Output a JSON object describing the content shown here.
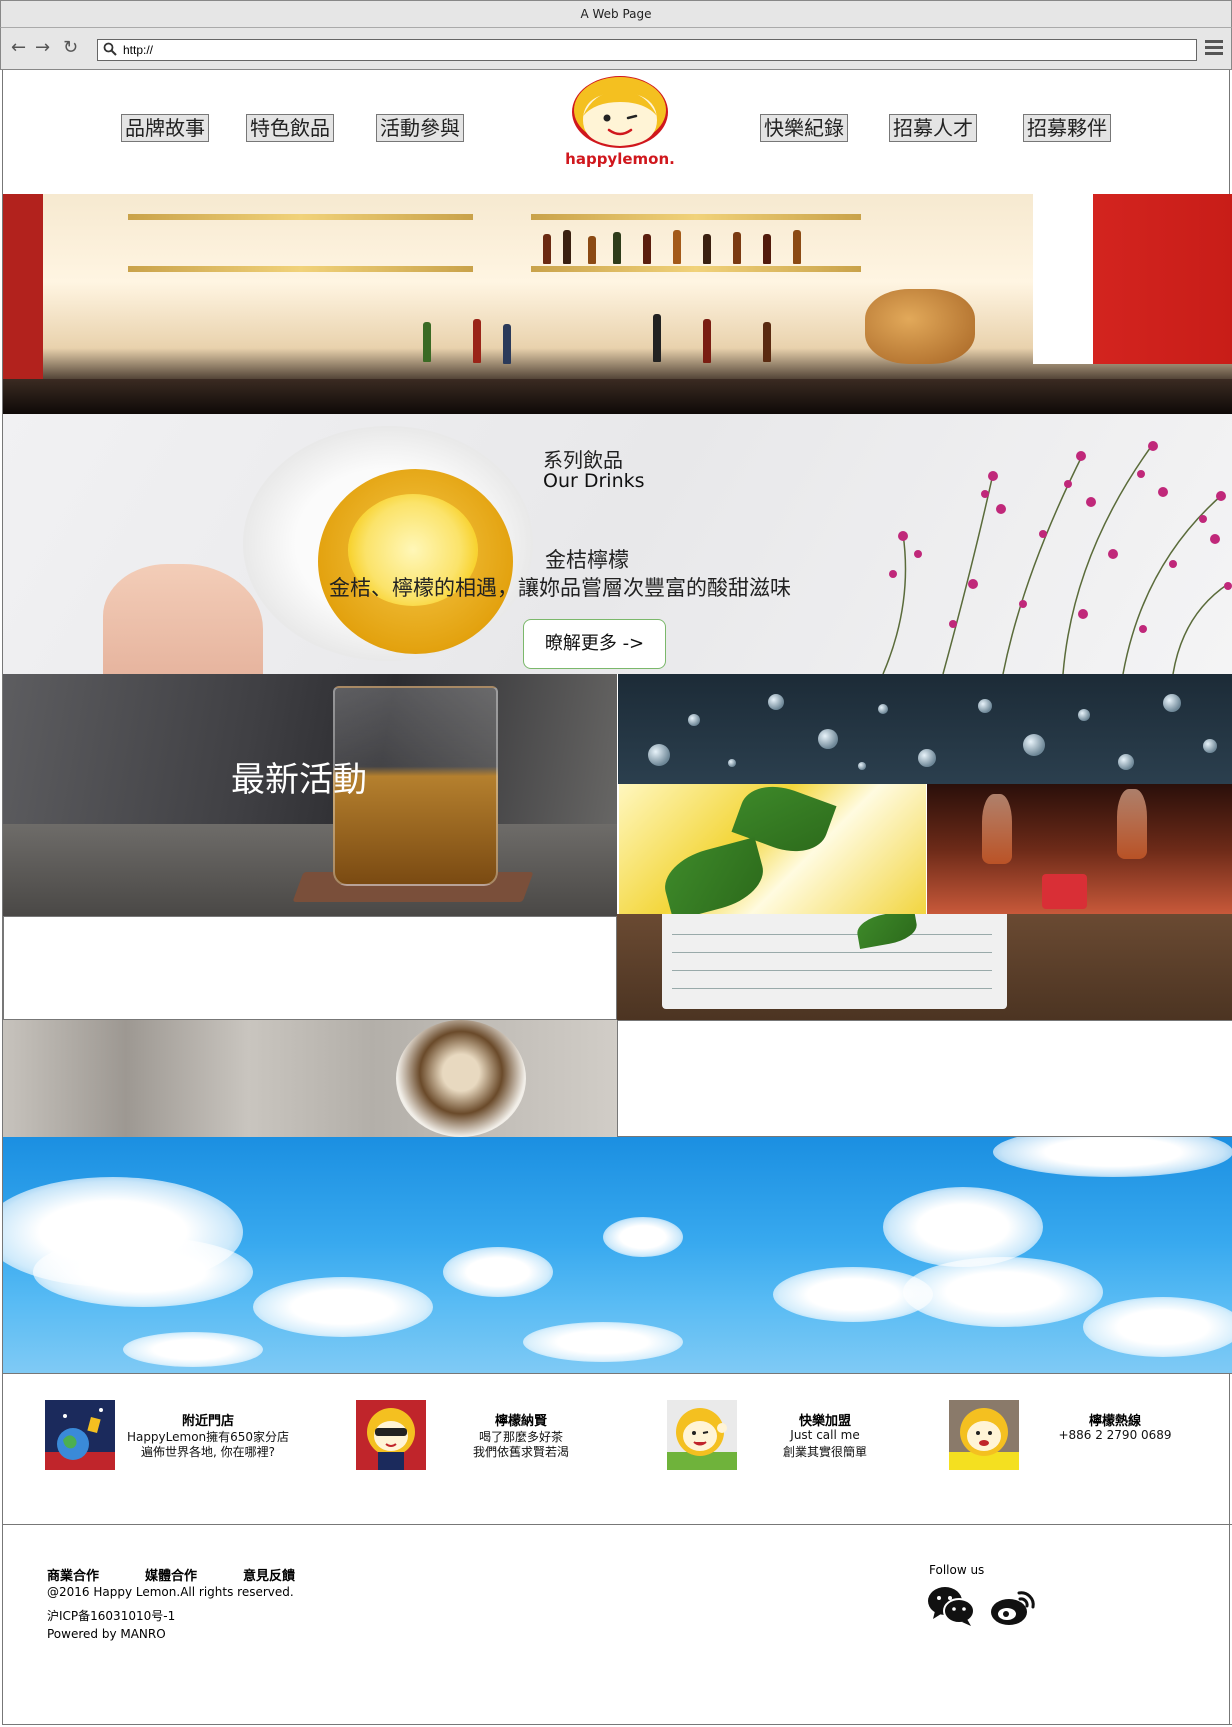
{
  "browser": {
    "title": "A Web Page",
    "url": "http://",
    "icons": [
      "back-arrow-icon",
      "forward-arrow-icon",
      "reload-icon",
      "search-icon",
      "hamburger-menu-icon"
    ]
  },
  "nav": {
    "left": [
      {
        "label": "品牌故事"
      },
      {
        "label": "特色飲品"
      },
      {
        "label": "活動參與"
      }
    ],
    "right": [
      {
        "label": "快樂紀錄"
      },
      {
        "label": "招募人才"
      },
      {
        "label": "招募夥伴"
      }
    ],
    "logo_text": "happylemon."
  },
  "drinks": {
    "title": "系列飲品",
    "subtitle": "Our Drinks",
    "name": "金桔檸檬",
    "description": "金桔、檸檬的相遇，讓妳品嘗層次豐富的酸甜滋味",
    "button": "暸解更多 ->"
  },
  "activities": {
    "title": "最新活動"
  },
  "cards": [
    {
      "title": "附近門店",
      "lines": [
        "HappyLemon擁有650家分店",
        "遍佈世界各地, 你在哪裡?"
      ]
    },
    {
      "title": "檸檬納賢",
      "lines": [
        "喝了那麼多好茶",
        "我們依舊求賢若渴"
      ]
    },
    {
      "title": "快樂加盟",
      "lines": [
        "Just call me",
        "創業其實很簡單"
      ]
    },
    {
      "title": "檸檬熱線",
      "lines": [
        "+886 2 2790 0689"
      ]
    }
  ],
  "footer": {
    "links": [
      "商業合作",
      "媒體合作",
      "意見反饋"
    ],
    "copyright": "@2016 Happy Lemon.All rights reserved.",
    "icp": "沪ICP备16031010号-1",
    "powered": "Powered by MANRO",
    "follow_label": "Follow us",
    "social_icons": [
      "wechat-icon",
      "weibo-icon"
    ]
  },
  "colors": {
    "logo_red": "#d0171d",
    "logo_yellow": "#f4c020",
    "button_border": "#7bb86b",
    "frame_gray": "#777777"
  }
}
